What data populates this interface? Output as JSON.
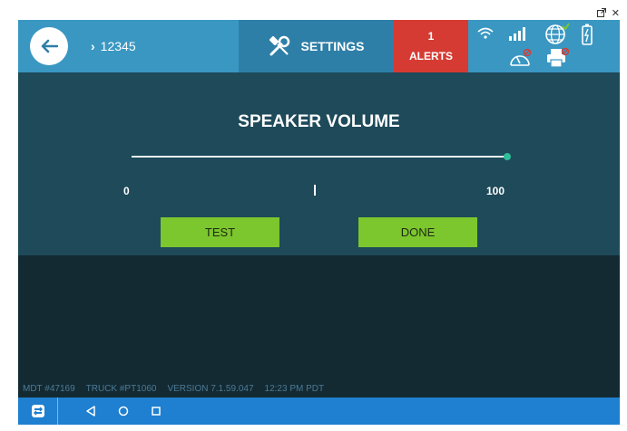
{
  "window": {
    "popout_icon": "popout-icon",
    "close_label": "✕"
  },
  "header": {
    "crumb_chevron": "›",
    "crumb_label": "12345",
    "settings_label": "SETTINGS",
    "alerts_count": "1",
    "alerts_label": "ALERTS"
  },
  "panel": {
    "title": "SPEAKER VOLUME",
    "volume_value": 100,
    "scale_min": "0",
    "scale_max": "100",
    "test_label": "TEST",
    "done_label": "DONE"
  },
  "status": {
    "mdt": "MDT #47169",
    "truck": "TRUCK #PT1060",
    "version": "VERSION  7.1.59.047",
    "time": "12:23 PM PDT"
  },
  "colors": {
    "header": "#3a97c2",
    "settings_tab": "#2e7fa7",
    "alerts": "#d63b33",
    "panel": "#1e4a5a",
    "button": "#7cc62e",
    "navbar": "#1f7fd0"
  }
}
